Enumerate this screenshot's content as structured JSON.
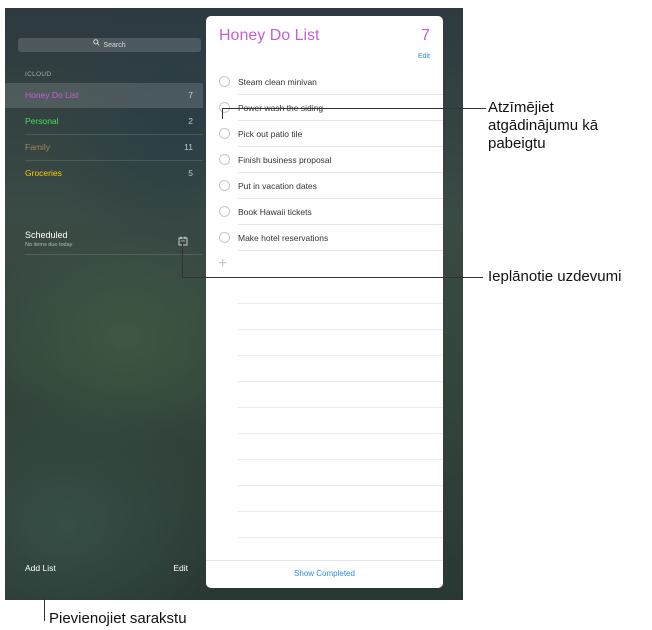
{
  "sidebar": {
    "search_placeholder": "Search",
    "section_header": "ICLOUD",
    "lists": [
      {
        "name": "Honey Do List",
        "count": "7",
        "color": "#c55fd6",
        "selected": true
      },
      {
        "name": "Personal",
        "count": "2",
        "color": "#4cd964",
        "selected": false
      },
      {
        "name": "Family",
        "count": "11",
        "color": "#a2845e",
        "selected": false
      },
      {
        "name": "Groceries",
        "count": "5",
        "color": "#ffcc00",
        "selected": false
      }
    ],
    "scheduled": {
      "title": "Scheduled",
      "subtitle": "No items due today",
      "icon": "calendar-icon"
    },
    "add_list_label": "Add List",
    "edit_label": "Edit"
  },
  "list_view": {
    "title": "Honey Do List",
    "count": "7",
    "edit_label": "Edit",
    "accent_color": "#c55fd6",
    "reminders": [
      "Steam clean minivan",
      "Power wash the siding",
      "Pick out patio tile",
      "Finish business proposal",
      "Put in vacation dates",
      "Book Hawaii tickets",
      "Make hotel reservations"
    ],
    "add_icon": "plus-icon",
    "show_completed_label": "Show Completed"
  },
  "callouts": {
    "mark_complete": [
      "Atzīmējiet",
      "atgādinājumu kā",
      "pabeigtu"
    ],
    "scheduled": "Ieplānotie uzdevumi",
    "add_list": "Pievienojiet sarakstu"
  }
}
